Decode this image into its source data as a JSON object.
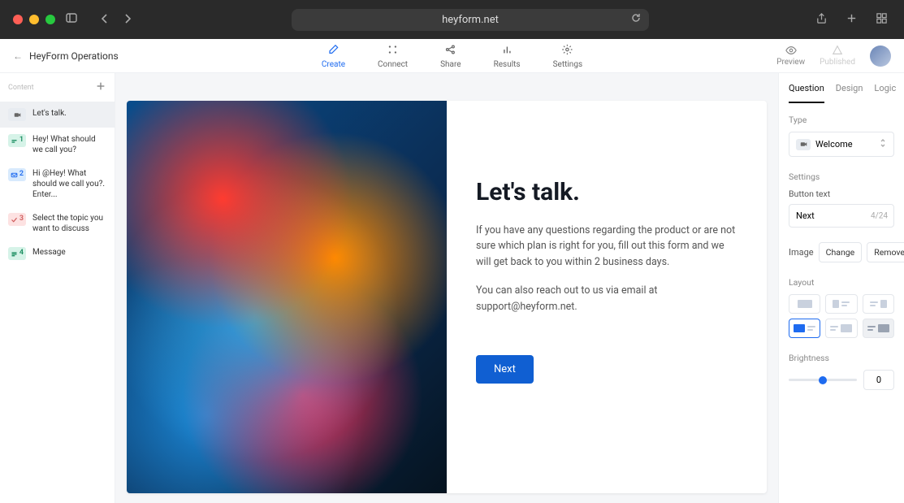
{
  "browser": {
    "url": "heyform.net"
  },
  "breadcrumb": {
    "back": "←",
    "title": "HeyForm Operations"
  },
  "tabs": {
    "create": "Create",
    "connect": "Connect",
    "share": "Share",
    "results": "Results",
    "settings": "Settings"
  },
  "topactions": {
    "preview": "Preview",
    "published": "Published"
  },
  "sidebar": {
    "header": "Content",
    "items": [
      {
        "label": "Let's talk."
      },
      {
        "num": "1",
        "label": "Hey! What should we call you?"
      },
      {
        "num": "2",
        "label": "Hi @Hey! What should we call you?. Enter..."
      },
      {
        "num": "3",
        "label": "Select the topic you want to discuss"
      },
      {
        "num": "4",
        "label": "Message"
      }
    ]
  },
  "canvas": {
    "title": "Let's talk.",
    "para1": "If you have any questions regarding the product or are not sure which plan is right for you, fill out this form and we will get back to you within 2 business days.",
    "para2": "You can also reach out to us via email at support@heyform.net.",
    "button": "Next"
  },
  "panel": {
    "tabs": {
      "question": "Question",
      "design": "Design",
      "logic": "Logic"
    },
    "type_label": "Type",
    "type_value": "Welcome",
    "settings_label": "Settings",
    "button_text_label": "Button text",
    "button_text_value": "Next",
    "button_text_count": "4/24",
    "image_label": "Image",
    "change": "Change",
    "remove": "Remove",
    "layout_label": "Layout",
    "brightness_label": "Brightness",
    "brightness_value": "0"
  }
}
